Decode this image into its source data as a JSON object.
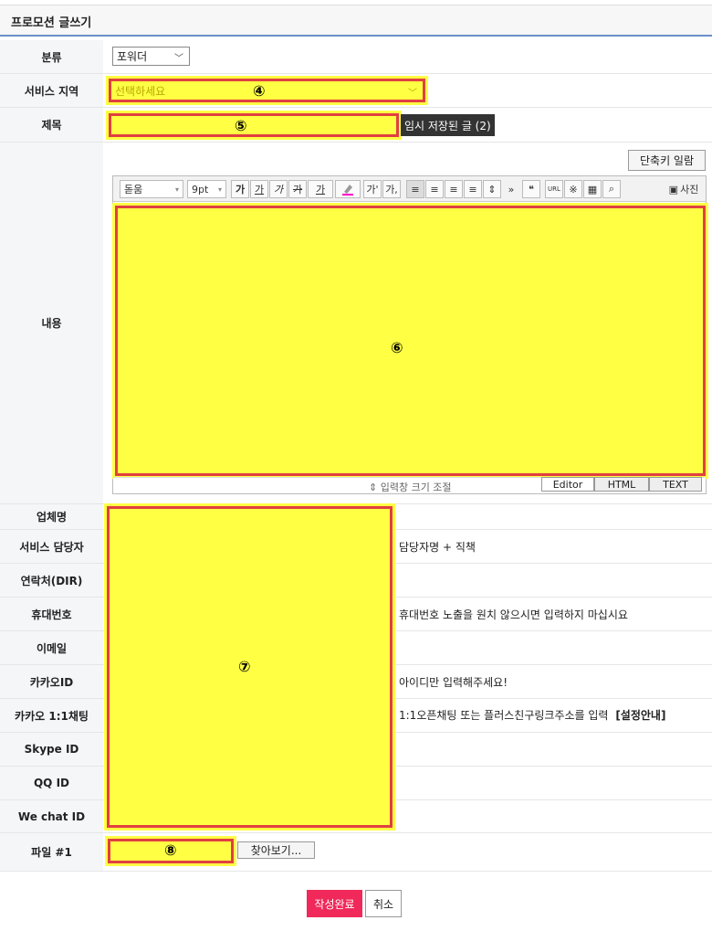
{
  "page": {
    "title": "프로모션 글쓰기"
  },
  "form": {
    "category": {
      "label": "분류",
      "value": "포워더"
    },
    "region": {
      "label": "서비스 지역",
      "placeholder": "선택하세요",
      "marker": "④"
    },
    "subject": {
      "label": "제목",
      "marker": "⑤",
      "temp_saved": "임시 저장된 글 (2)"
    },
    "content": {
      "label": "내용",
      "shortcut_button": "단축키 일람",
      "toolbar": {
        "font": "돋움",
        "size": "9pt",
        "bold": "가",
        "underline": "가",
        "italic": "가",
        "strike": "가",
        "fontcolor": "가",
        "sup": "가'",
        "sub": "가,",
        "quote": "❝",
        "url": "URL",
        "special": "※",
        "photo": "사진"
      },
      "marker": "⑥",
      "resize_label": "⇕ 입력창 크기 조절",
      "modes": [
        "Editor",
        "HTML",
        "TEXT"
      ]
    },
    "company": {
      "label": "업체명"
    },
    "manager": {
      "label": "서비스 담당자",
      "note": "담당자명 + 직책"
    },
    "contact": {
      "label": "연락처(DIR)"
    },
    "mobile": {
      "label": "휴대번호",
      "note": "휴대번호 노출을 원치 않으시면 입력하지 마십시요"
    },
    "email": {
      "label": "이메일"
    },
    "kakao_id": {
      "label": "카카오ID",
      "note": "아이디만 입력해주세요!"
    },
    "kakao_chat": {
      "label": "카카오 1:1채팅",
      "note": "1:1오픈채팅 또는 플러스친구링크주소를 입력",
      "guide": "[설정안내]"
    },
    "skype": {
      "label": "Skype ID"
    },
    "qq": {
      "label": "QQ ID"
    },
    "wechat": {
      "label": "We chat ID"
    },
    "contacts_marker": "⑦",
    "file": {
      "label": "파일 #1",
      "marker": "⑧",
      "browse": "찾아보기..."
    }
  },
  "actions": {
    "submit": "작성완료",
    "cancel": "취소"
  },
  "colors": {
    "highlight": "#ffff44",
    "highlight_border": "#e04040",
    "submit_bg": "#f0295a",
    "title_rule": "#6b8fc7"
  }
}
